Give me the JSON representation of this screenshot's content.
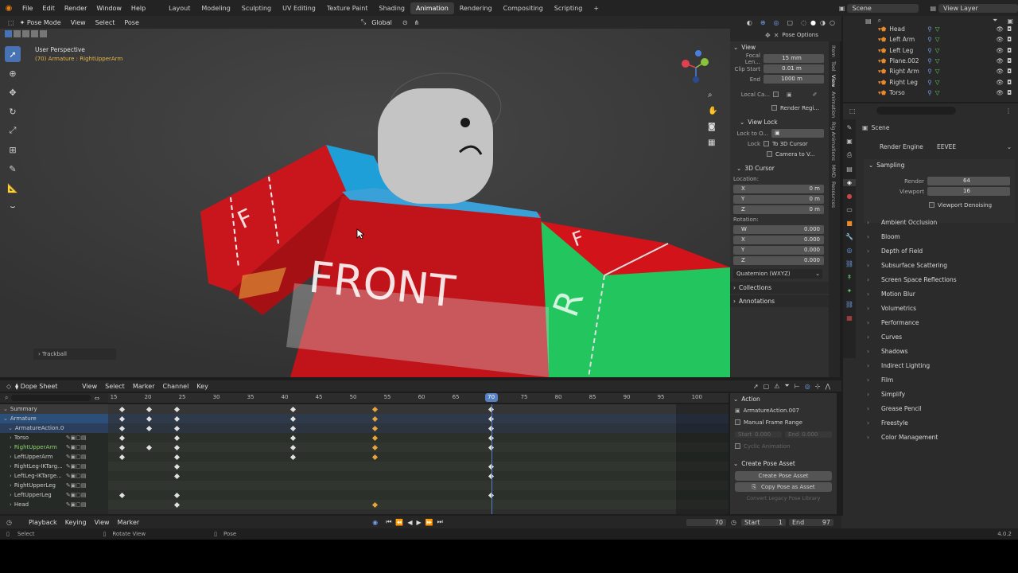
{
  "menubar": {
    "items": [
      "File",
      "Edit",
      "Render",
      "Window",
      "Help"
    ],
    "workspaces": [
      "Layout",
      "Modeling",
      "Sculpting",
      "UV Editing",
      "Texture Paint",
      "Shading",
      "Animation",
      "Rendering",
      "Compositing",
      "Scripting"
    ],
    "active_workspace": "Animation",
    "add_tab": "+",
    "scene": "Scene",
    "view_layer": "View Layer"
  },
  "viewport_header": {
    "mode": "Pose Mode",
    "menus": [
      "View",
      "Select",
      "Pose"
    ],
    "orientation": "Global",
    "pose_options": "Pose Options"
  },
  "viewport": {
    "perspective": "User Perspective",
    "active_object": "(70) Armature : RightUpperArm",
    "model_text_front": "FRONT",
    "last_op": "Trackball"
  },
  "npanel": {
    "view": {
      "title": "View",
      "focal_label": "Focal Len...",
      "focal": "15 mm",
      "clip_start_label": "Clip Start",
      "clip_start": "0.01 m",
      "end_label": "End",
      "clip_end": "1000 m",
      "local_camera": "Local Ca...",
      "render_region": "Render Regi..."
    },
    "view_lock": {
      "title": "View Lock",
      "lock_to": "Lock to O...",
      "lock": "Lock",
      "to_cursor": "To 3D Cursor",
      "camera_to_view": "Camera to V..."
    },
    "cursor": {
      "title": "3D Cursor",
      "location": "Location:",
      "x": "0 m",
      "y": "0 m",
      "z": "0 m",
      "rotation": "Rotation:",
      "w": "0.000",
      "rx": "0.000",
      "ry": "0.000",
      "rz": "0.000",
      "mode": "Quaternion (WXYZ)"
    },
    "collections": "Collections",
    "annotations": "Annotations",
    "tabs": [
      "Item",
      "Tool",
      "View",
      "Animation",
      "Rig Animations",
      "MMD",
      "Resources"
    ]
  },
  "outliner": {
    "items": [
      "Head",
      "Left Arm",
      "Left Leg",
      "Plane.002",
      "Right Arm",
      "Right Leg",
      "Torso"
    ]
  },
  "properties": {
    "scene": "Scene",
    "render_engine_label": "Render Engine",
    "render_engine": "EEVEE",
    "sampling": "Sampling",
    "render_label": "Render",
    "render_val": "64",
    "viewport_label": "Viewport",
    "viewport_val": "16",
    "viewport_denoising": "Viewport Denoising",
    "sections": [
      "Ambient Occlusion",
      "Bloom",
      "Depth of Field",
      "Subsurface Scattering",
      "Screen Space Reflections",
      "Motion Blur",
      "Volumetrics",
      "Performance",
      "Curves",
      "Shadows",
      "Indirect Lighting",
      "Film",
      "Simplify",
      "Grease Pencil",
      "Freestyle",
      "Color Management"
    ]
  },
  "dopesheet": {
    "mode": "Dope Sheet",
    "menus": [
      "View",
      "Select",
      "Marker",
      "Channel",
      "Key"
    ],
    "ruler": [
      "15",
      "20",
      "25",
      "30",
      "35",
      "40",
      "45",
      "50",
      "55",
      "60",
      "65",
      "70",
      "75",
      "80",
      "85",
      "90",
      "95",
      "100"
    ],
    "current_frame": "70",
    "channels": [
      "Summary",
      "Armature",
      "ArmatureAction.007",
      "Torso",
      "RightUpperArm",
      "LeftUpperArm",
      "RightLeg-IKTarg...",
      "LeftLeg-IKTarge...",
      "RightUpperLeg",
      "LeftUpperLeg",
      "Head"
    ]
  },
  "action_panel": {
    "title": "Action",
    "action_name": "ArmatureAction.007",
    "manual_range": "Manual Frame Range",
    "start": "Start",
    "start_val": "0.000",
    "end": "End",
    "end_val": "0.000",
    "cyclic": "Cyclic Animation",
    "pose_asset": "Create Pose Asset",
    "create_btn": "Create Pose Asset",
    "copy_btn": "Copy Pose as Asset",
    "convert": "Convert Legacy Pose Library"
  },
  "timeline": {
    "menus": [
      "Playback",
      "Keying",
      "View",
      "Marker"
    ],
    "frame": "70",
    "start_label": "Start",
    "start": "1",
    "end_label": "End",
    "end": "97"
  },
  "status": {
    "select": "Select",
    "rotate": "Rotate View",
    "pose": "Pose",
    "version": "4.0.2"
  },
  "colors": {
    "accent": "#4772b3",
    "frame": "#5680c2",
    "key": "#e8a33a",
    "model_red": "#c8161c",
    "model_blue": "#1e9fd8",
    "model_green": "#22c55e"
  }
}
